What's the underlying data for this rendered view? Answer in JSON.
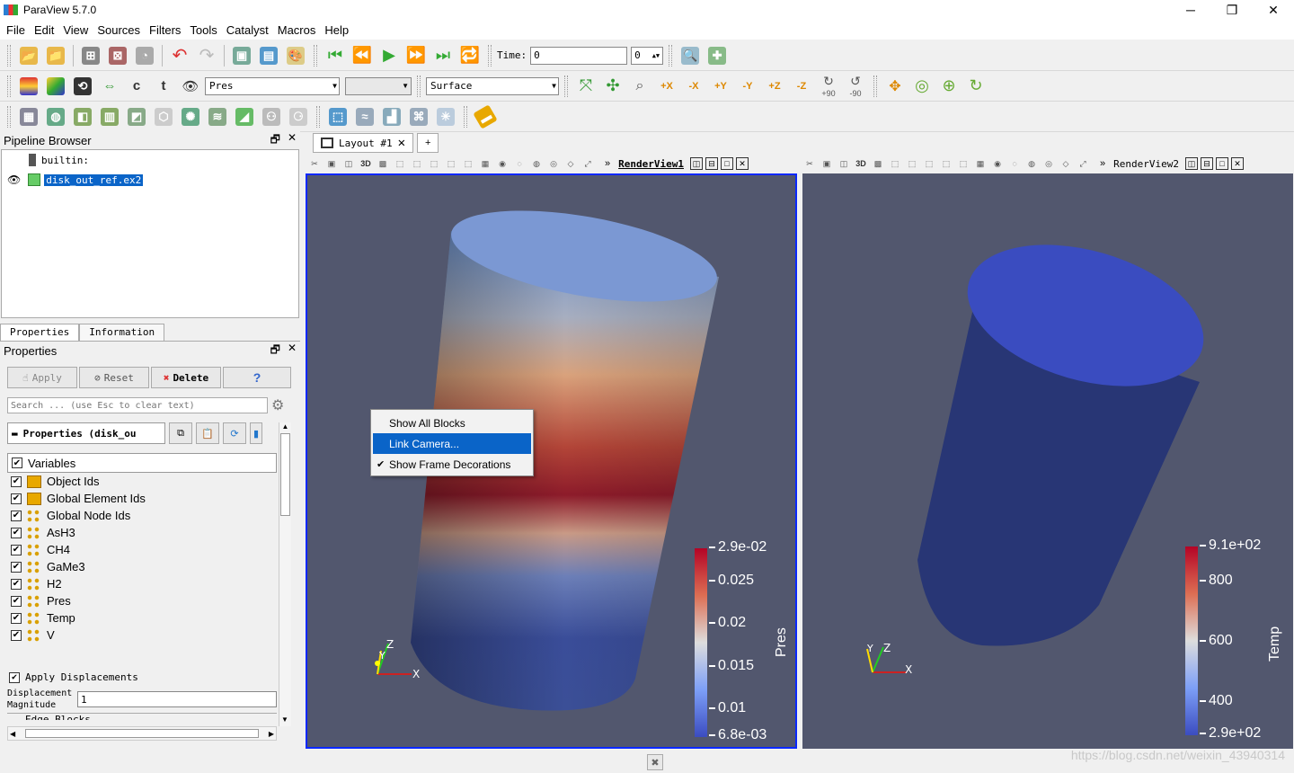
{
  "window": {
    "title": "ParaView 5.7.0",
    "min": "─",
    "max": "❐",
    "close": "✕"
  },
  "menu": [
    "File",
    "Edit",
    "View",
    "Sources",
    "Filters",
    "Tools",
    "Catalyst",
    "Macros",
    "Help"
  ],
  "toolbar1": {
    "time_label": "Time:",
    "time_value": "0",
    "time_step": "0"
  },
  "toolbar2": {
    "array": "Pres",
    "component": "",
    "representation": "Surface",
    "rot_plus": "+90",
    "rot_minus": "-90"
  },
  "pipeline": {
    "title": "Pipeline Browser",
    "root": "builtin:",
    "source": "disk_out_ref.ex2"
  },
  "properties": {
    "tabs": [
      "Properties",
      "Information"
    ],
    "title": "Properties",
    "apply": "Apply",
    "reset": "Reset",
    "delete": "Delete",
    "help": "?",
    "search_placeholder": "Search ... (use Esc to clear text)",
    "group_header": "Properties (disk_ou",
    "variables_header": "Variables",
    "variables": [
      {
        "name": "Object Ids",
        "kind": "cell"
      },
      {
        "name": "Global Element Ids",
        "kind": "cell"
      },
      {
        "name": "Global Node Ids",
        "kind": "point"
      },
      {
        "name": "AsH3",
        "kind": "point"
      },
      {
        "name": "CH4",
        "kind": "point"
      },
      {
        "name": "GaMe3",
        "kind": "point"
      },
      {
        "name": "H2",
        "kind": "point"
      },
      {
        "name": "Pres",
        "kind": "point"
      },
      {
        "name": "Temp",
        "kind": "point"
      },
      {
        "name": "V",
        "kind": "point"
      }
    ],
    "apply_displacements": "Apply Displacements",
    "displacement_label_1": "Displacement",
    "displacement_label_2": "Magnitude",
    "displacement_value": "1",
    "edge_blocks": "Edge Blocks"
  },
  "layout": {
    "tab": "Layout #1",
    "add": "+"
  },
  "view1": {
    "name": "RenderView1",
    "colorbar": {
      "title": "Pres",
      "ticks": [
        "2.9e-02",
        "0.025",
        "0.02",
        "0.015",
        "0.01",
        "6.8e-03"
      ]
    }
  },
  "view2": {
    "name": "RenderView2",
    "colorbar": {
      "title": "Temp",
      "ticks": [
        "9.1e+02",
        "800",
        "600",
        "400",
        "2.9e+02"
      ]
    }
  },
  "axes": {
    "x": "X",
    "y": "Y",
    "z": "Z"
  },
  "context_menu": [
    "Show All Blocks",
    "Link Camera...",
    "Show Frame Decorations"
  ],
  "watermark": "https://blog.csdn.net/weixin_43940314",
  "colors": {
    "selection": "#0a64c8",
    "render_bg": "#52576e",
    "active_view_border": "#0a28ff"
  }
}
